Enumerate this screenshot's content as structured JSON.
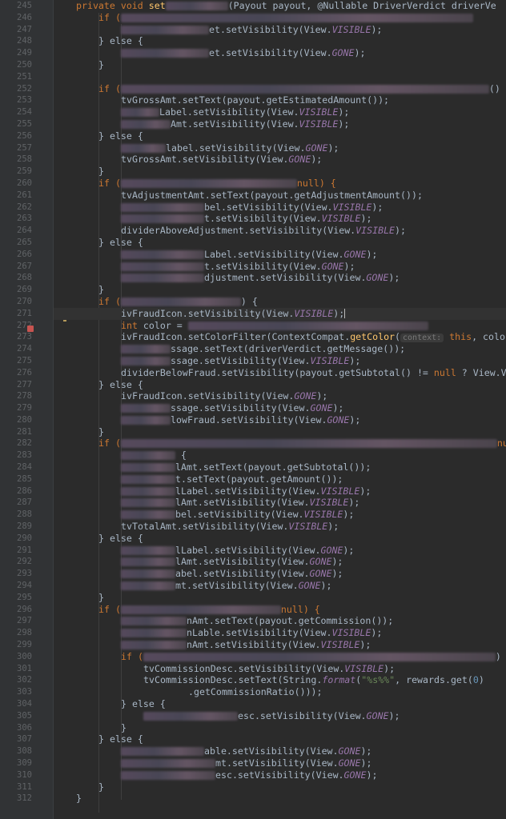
{
  "editor": {
    "language": "java",
    "first_line_number": 245,
    "current_line": 271,
    "breakpoint_line": 272,
    "bulb_line": 271
  },
  "line_numbers": [
    "245",
    "246",
    "247",
    "248",
    "249",
    "250",
    "251",
    "252",
    "253",
    "254",
    "255",
    "256",
    "257",
    "258",
    "259",
    "260",
    "261",
    "262",
    "263",
    "264",
    "265",
    "266",
    "267",
    "268",
    "269",
    "270",
    "271",
    "272",
    "273",
    "274",
    "275",
    "276",
    "277",
    "278",
    "279",
    "280",
    "281",
    "282",
    "283",
    "284",
    "285",
    "286",
    "287",
    "288",
    "289",
    "290",
    "291",
    "292",
    "293",
    "294",
    "295",
    "296",
    "297",
    "298",
    "299",
    "300",
    "301",
    "302",
    "303",
    "304",
    "305",
    "306",
    "307",
    "308",
    "309",
    "310",
    "311",
    "312"
  ],
  "code": {
    "l245_a": "private void ",
    "l245_b": "set",
    "l245_c": "(Payout payout, @Nullable DriverVerdict driverVe",
    "l246_a": "if (",
    "l247_b": "et.setVisibility(View.",
    "l247_c": "VISIBLE",
    "l247_d": ");",
    "l248": "} else {",
    "l249_b": "et.setVisibility(View.",
    "l249_c": "GONE",
    "l249_d": ");",
    "l250": "}",
    "l252_a": "if (",
    "l252_c": "()",
    "l253": "tvGrossAmt.setText(payout.getEstimatedAmount());",
    "l254_a": "Label.setVisibility(View.",
    "l254_b": "VISIBLE",
    "l255_a": "Amt.setVisibility(View.",
    "l255_b": "VISIBLE",
    "l256": "} else {",
    "l257_a": "label.setVisibility(View.",
    "l257_b": "GONE",
    "l258_a": "tvGrossAmt.setVisibility(View.",
    "l258_b": "GONE",
    "l259": "}",
    "l260_a": "if (",
    "l260_c": "null) {",
    "l261": "tvAdjustmentAmt.setText(payout.getAdjustmentAmount());",
    "l262_a": "bel.setVisibility(View.",
    "l262_b": "VISIBLE",
    "l263_a": "t.setVisibility(View.",
    "l263_b": "VISIBLE",
    "l264_a": "dividerAboveAdjustment.setVisibility(View.",
    "l264_b": "VISIBLE",
    "l265": "} else {",
    "l266_a": "Label.setVisibility(View.",
    "l266_b": "GONE",
    "l267_a": "t.setVisibility(View.",
    "l267_b": "GONE",
    "l268_a": "djustment.setVisibility(View.",
    "l268_b": "GONE",
    "l269": "}",
    "l270_a": "if (",
    "l270_c": ") {",
    "l271_a": "ivFraudIcon.setVisibility(View.",
    "l271_b": "VISIBLE",
    "l271_c": ");",
    "l272_a": "int ",
    "l272_b": "color = ",
    "l273_a": "ivFraudIcon.setColorFilter(ContextCompat.",
    "l273_b": "getColor",
    "l273_c": "(",
    "l273_hint": "context:",
    "l273_d": " this",
    "l273_e": ", color",
    "l274": "ssage.setText(driverVerdict.getMessage());",
    "l275_a": "ssage.setVisibility(View.",
    "l275_b": "VISIBLE",
    "l276_a": "dividerBelowFraud.setVisibility(payout.getSubtotal() != ",
    "l276_b": "null",
    "l276_c": " ? View.VI",
    "l277": "} else {",
    "l278_a": "ivFraudIcon.setVisibility(View.",
    "l278_b": "GONE",
    "l279_a": "ssage.setVisibility(View.",
    "l279_b": "GONE",
    "l280_a": "lowFraud.setVisibility(View.",
    "l280_b": "GONE",
    "l281": "}",
    "l282_a": "if (",
    "l282_c": "nul",
    "l283": "{",
    "l284": "lAmt.setText(payout.getSubtotal());",
    "l285": "t.setText(payout.getAmount());",
    "l286_a": "lLabel.setVisibility(View.",
    "l286_b": "VISIBLE",
    "l287_a": "lAmt.setVisibility(View.",
    "l287_b": "VISIBLE",
    "l288_a": "bel.setVisibility(View.",
    "l288_b": "VISIBLE",
    "l289_a": "tvTotalAmt.setVisibility(View.",
    "l289_b": "VISIBLE",
    "l290": "} else {",
    "l291_a": "lLabel.setVisibility(View.",
    "l291_b": "GONE",
    "l292_a": "lAmt.setVisibility(View.",
    "l292_b": "GONE",
    "l293_a": "abel.setVisibility(View.",
    "l293_b": "GONE",
    "l294_a": "mt.setVisibility(View.",
    "l294_b": "GONE",
    "l295": "}",
    "l296_a": "if (",
    "l296_c": "null) {",
    "l297": "nAmt.setText(payout.getCommission());",
    "l298_a": "nLable.setVisibility(View.",
    "l298_b": "VISIBLE",
    "l299_a": "nAmt.setVisibility(View.",
    "l299_b": "VISIBLE",
    "l300_a": "if (",
    "l300_c": ")",
    "l301_a": "tvCommissionDesc.setVisibility(View.",
    "l301_b": "VISIBLE",
    "l302_a": "tvCommissionDesc.setText(String.",
    "l302_b": "format",
    "l302_c": "(",
    "l302_d": "\"%s%%\"",
    "l302_e": ", rewards.get(",
    "l302_f": "0",
    "l302_g": ")",
    "l303": ".getCommissionRatio()));",
    "l304": "} else {",
    "l305_a": "esc.setVisibility(View.",
    "l305_b": "GONE",
    "l306": "}",
    "l307": "} else {",
    "l308_a": "able.setVisibility(View.",
    "l308_b": "GONE",
    "l309_a": "mt.setVisibility(View.",
    "l309_b": "GONE",
    "l310_a": "esc.setVisibility(View.",
    "l310_b": "GONE",
    "l311": "}",
    "l312": "}",
    "close_paren": ");"
  }
}
